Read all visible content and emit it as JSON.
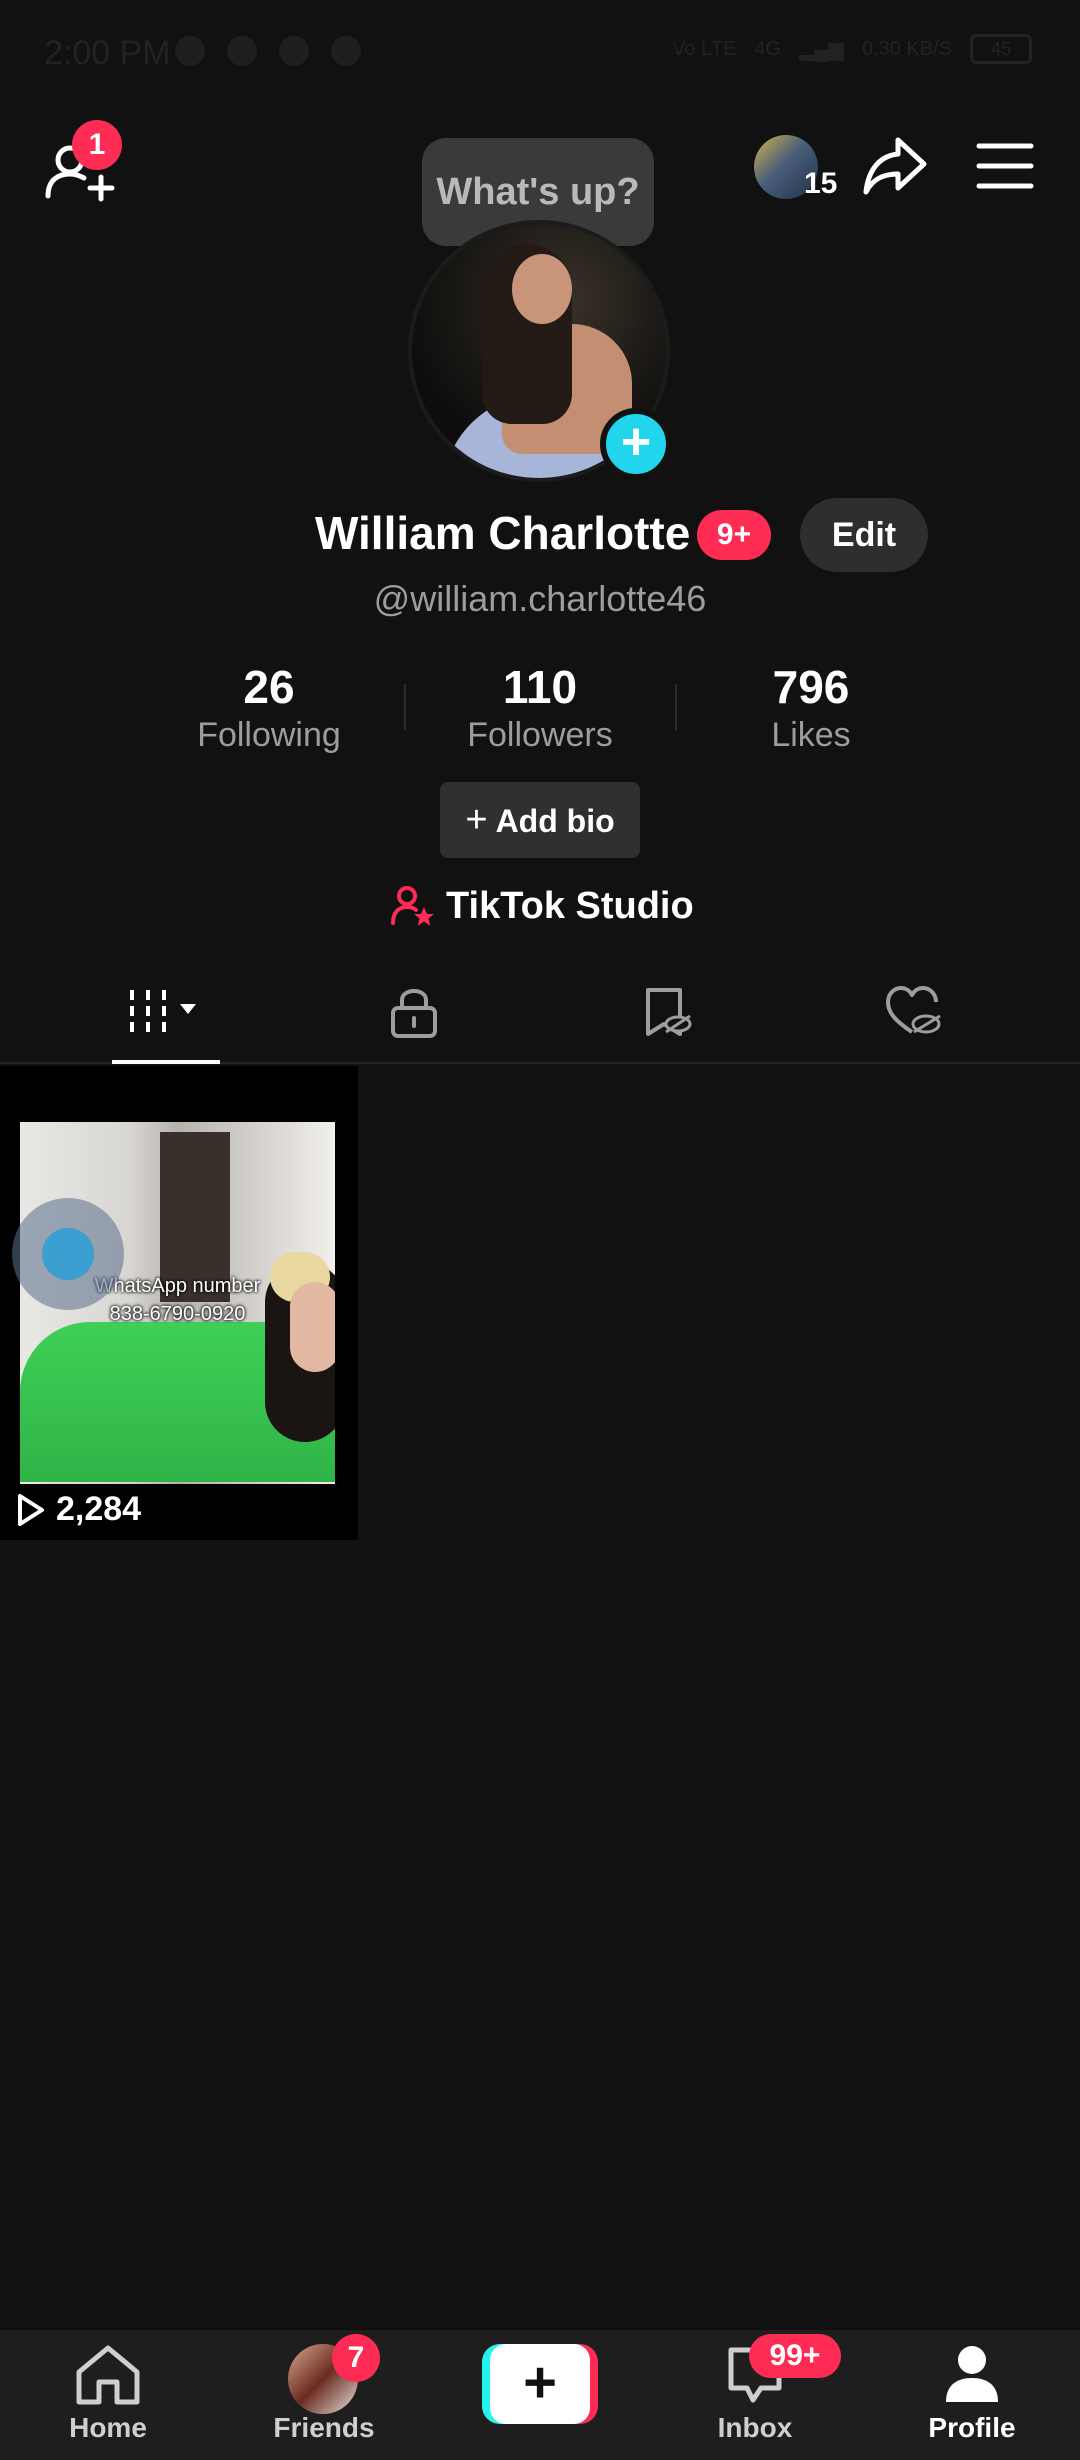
{
  "status_bar": {
    "time": "2:00 PM",
    "network_labels": [
      "Vo LTE",
      "4G",
      "0.30 KB/S"
    ],
    "battery": "45"
  },
  "top_bar": {
    "add_friend_badge": "1",
    "whats_up": "What's up?",
    "visitor_count": "15"
  },
  "profile": {
    "display_name": "William Charlotte",
    "name_badge": "9+",
    "edit_label": "Edit",
    "username": "@william.charlotte46",
    "stats": [
      {
        "value": "26",
        "label": "Following"
      },
      {
        "value": "110",
        "label": "Followers"
      },
      {
        "value": "796",
        "label": "Likes"
      }
    ],
    "add_bio_plus": "+",
    "add_bio_label": "Add bio",
    "studio_label": "TikTok Studio"
  },
  "tabs": [
    {
      "icon": "grid-icon",
      "active": true
    },
    {
      "icon": "lock-icon",
      "active": false
    },
    {
      "icon": "bookmark-hidden-icon",
      "active": false
    },
    {
      "icon": "heart-hidden-icon",
      "active": false
    }
  ],
  "videos": [
    {
      "overlay_line1": "WhatsApp number",
      "overlay_line2": "838-6790-0920",
      "views": "2,284"
    }
  ],
  "bottom_nav": {
    "home": "Home",
    "friends": "Friends",
    "friends_badge": "7",
    "create": "+",
    "inbox": "Inbox",
    "inbox_badge": "99+",
    "profile": "Profile"
  },
  "colors": {
    "background": "#111111",
    "accent_red": "#fe2c55",
    "accent_cyan": "#20d5ec",
    "secondary_text": "#9d9d9d"
  }
}
